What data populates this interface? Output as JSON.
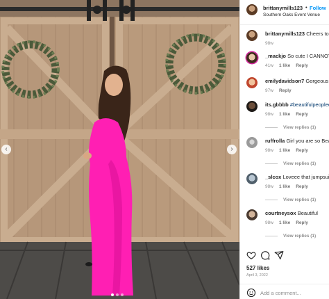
{
  "post": {
    "username": "brittanymills123",
    "follow_label": "Follow",
    "separator": "•",
    "location": "Southern Oaks Event Venue"
  },
  "comments": [
    {
      "user": "brittanymills123",
      "text": "Cheers to Th",
      "time": "98w"
    },
    {
      "user": "_mackjo",
      "text": "So cute I CANNOT ",
      "time": "41w",
      "likes": "1 like",
      "reply_label": "Reply"
    },
    {
      "user": "emilydavidson7",
      "text": "Gorgeous ",
      "time": "97w",
      "reply_label": "Reply"
    },
    {
      "user": "its.gbbbb",
      "text": "#beautifulpeoplec",
      "time": "98w",
      "likes": "1 like",
      "reply_label": "Reply",
      "view_replies": "View replies (1)"
    },
    {
      "user": "ruffrolla",
      "text": "Girl you are so Beau",
      "time": "98w",
      "likes": "1 like",
      "reply_label": "Reply",
      "view_replies": "View replies (1)"
    },
    {
      "user": "_slcox",
      "text": "Loveee that jumpsuit!!",
      "time": "98w",
      "likes": "1 like",
      "reply_label": "Reply",
      "view_replies": "View replies (1)"
    },
    {
      "user": "courtneysox",
      "text": "Beautiful",
      "time": "98w",
      "likes": "1 like",
      "reply_label": "Reply",
      "view_replies": "View replies (1)"
    }
  ],
  "actions": {
    "icons": [
      "heart-icon",
      "comment-icon",
      "share-icon"
    ]
  },
  "likes": "527 likes",
  "date": "April 3, 2022",
  "add_comment": {
    "placeholder": "Add a comment..."
  },
  "carousel": {
    "slides": 3,
    "active_index": 0,
    "prev_icon": "‹",
    "next_icon": "›"
  },
  "colors": {
    "follow": "#0095f6",
    "hashtag": "#00376b",
    "dress": "#ff1fb3",
    "muted": "#8e8e8e"
  }
}
